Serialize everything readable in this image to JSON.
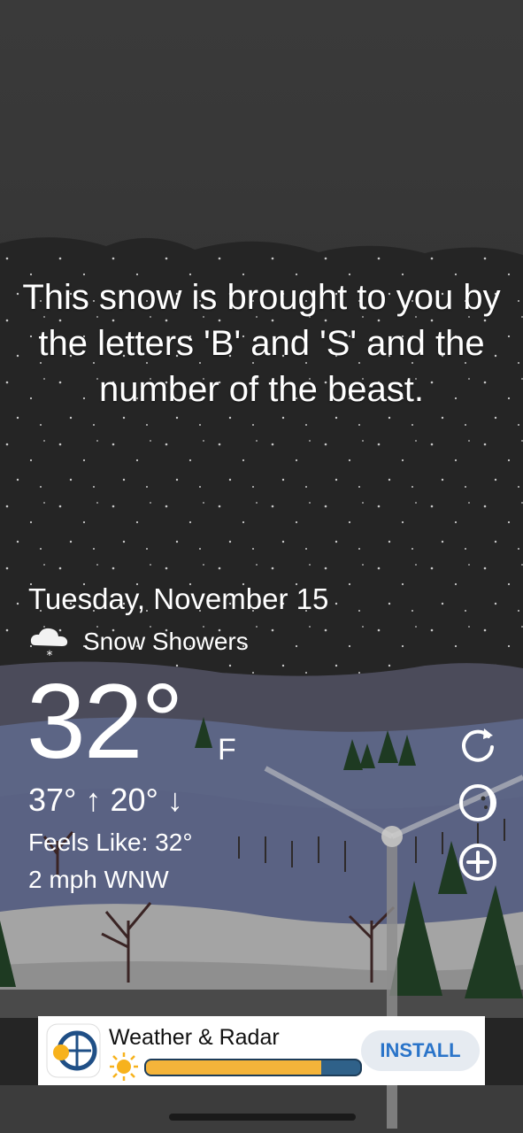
{
  "headline": "This snow is brought to you by the letters 'B' and 'S' and the number of the beast.",
  "date": "Tuesday, November 15",
  "condition": {
    "icon": "snow-cloud-icon",
    "label": "Snow Showers"
  },
  "temperature": {
    "value": "32°",
    "unit": "F"
  },
  "hilo": "37° ↑ 20° ↓",
  "feels_like": "Feels Like: 32°",
  "wind": "2 mph WNW",
  "side_buttons": [
    {
      "icon": "refresh-icon"
    },
    {
      "icon": "moon-phase-icon"
    },
    {
      "icon": "add-icon"
    }
  ],
  "ad": {
    "title": "Weather & Radar",
    "install_label": "INSTALL",
    "progress": 0.82,
    "colors": {
      "accent": "#2a74c9",
      "bar": "#2f6189",
      "fill": "#f4b43a"
    }
  }
}
